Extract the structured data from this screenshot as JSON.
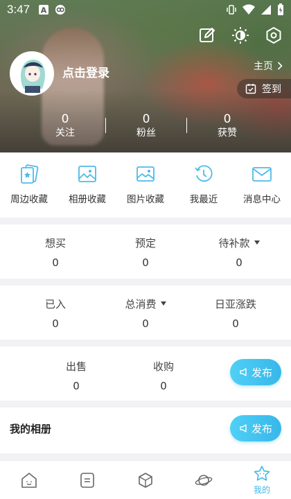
{
  "status_bar": {
    "time": "3:47"
  },
  "profile": {
    "login_prompt": "点击登录",
    "home_link": "主页",
    "checkin_label": "签到"
  },
  "stats": [
    {
      "value": "0",
      "label": "关注"
    },
    {
      "value": "0",
      "label": "粉丝"
    },
    {
      "value": "0",
      "label": "获赞"
    }
  ],
  "shortcuts": [
    {
      "label": "周边收藏",
      "icon": "cards-icon"
    },
    {
      "label": "相册收藏",
      "icon": "album-icon"
    },
    {
      "label": "图片收藏",
      "icon": "image-icon"
    },
    {
      "label": "我最近",
      "icon": "history-icon"
    },
    {
      "label": "消息中心",
      "icon": "mail-icon"
    }
  ],
  "purchase_stats": [
    {
      "label": "想买",
      "value": "0"
    },
    {
      "label": "预定",
      "value": "0"
    },
    {
      "label": "待补款",
      "value": "0"
    }
  ],
  "spending_stats": [
    {
      "label": "已入",
      "value": "0"
    },
    {
      "label": "总消费",
      "value": "0"
    },
    {
      "label": "日亚涨跌",
      "value": "0"
    }
  ],
  "trade_stats": [
    {
      "label": "出售",
      "value": "0"
    },
    {
      "label": "收购",
      "value": "0"
    }
  ],
  "publish_label": "发布",
  "album": {
    "title": "我的相册",
    "publish_label": "发布"
  },
  "bottom_nav": {
    "active_label": "我的"
  },
  "colors": {
    "accent": "#3cb8e8",
    "icon_blue": "#4dbbe8"
  }
}
